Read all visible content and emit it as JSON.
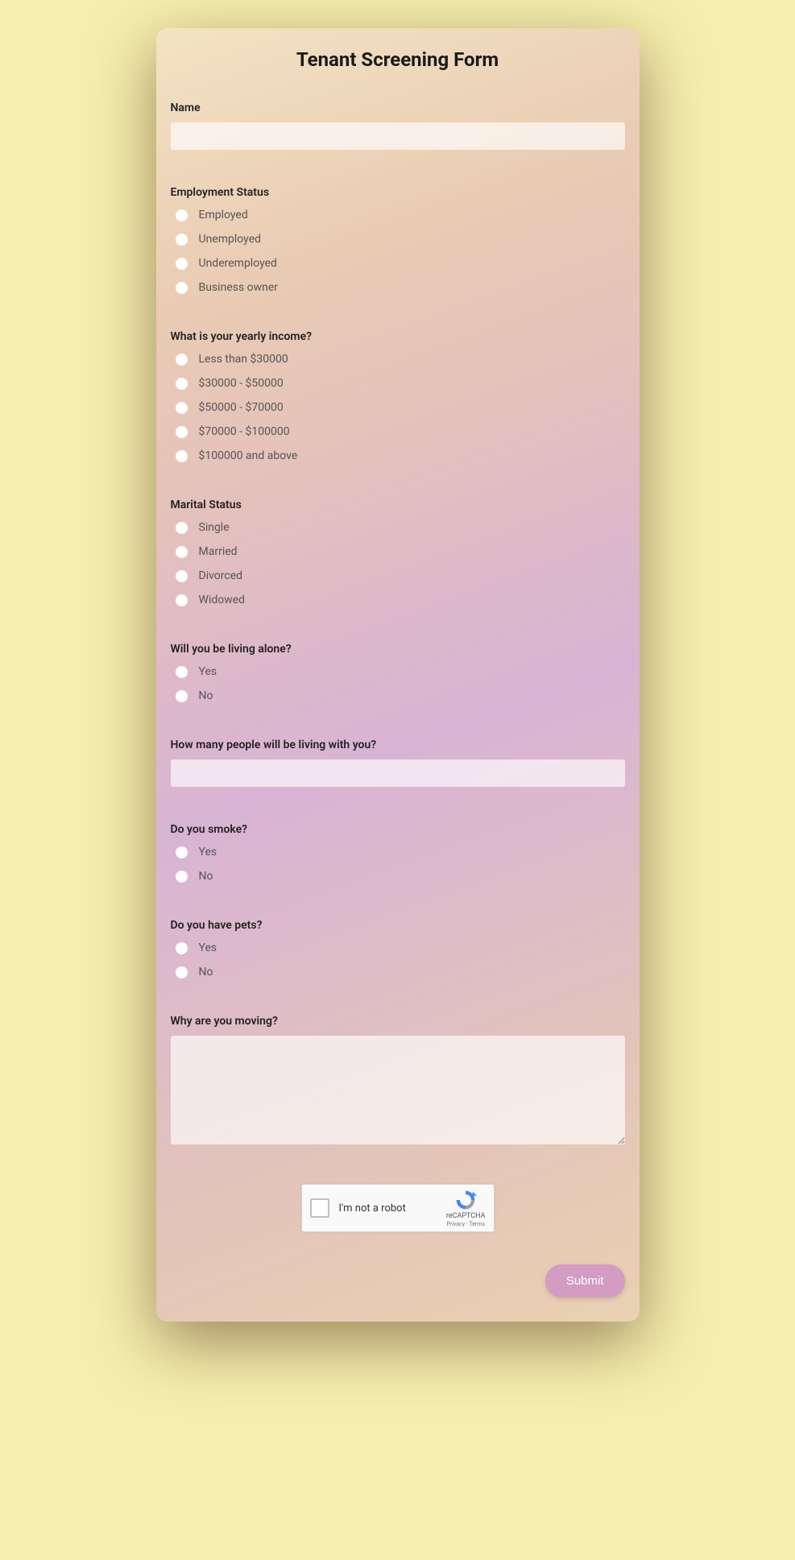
{
  "title": "Tenant Screening Form",
  "name": {
    "label": "Name",
    "value": ""
  },
  "employment": {
    "label": "Employment Status",
    "options": [
      "Employed",
      "Unemployed",
      "Underemployed",
      "Business owner"
    ]
  },
  "income": {
    "label": "What is your yearly income?",
    "options": [
      "Less than $30000",
      "$30000 - $50000",
      "$50000 - $70000",
      "$70000 - $100000",
      "$100000 and above"
    ]
  },
  "marital": {
    "label": "Marital Status",
    "options": [
      "Single",
      "Married",
      "Divorced",
      "Widowed"
    ]
  },
  "alone": {
    "label": "Will you be living alone?",
    "options": [
      "Yes",
      "No"
    ]
  },
  "people": {
    "label": "How many people will be living with you?",
    "value": ""
  },
  "smoke": {
    "label": "Do you smoke?",
    "options": [
      "Yes",
      "No"
    ]
  },
  "pets": {
    "label": "Do you have pets?",
    "options": [
      "Yes",
      "No"
    ]
  },
  "moving": {
    "label": "Why are you moving?",
    "value": ""
  },
  "recaptcha": {
    "text": "I'm not a robot",
    "brand": "reCAPTCHA",
    "links": "Privacy - Terms"
  },
  "submit": "Submit"
}
